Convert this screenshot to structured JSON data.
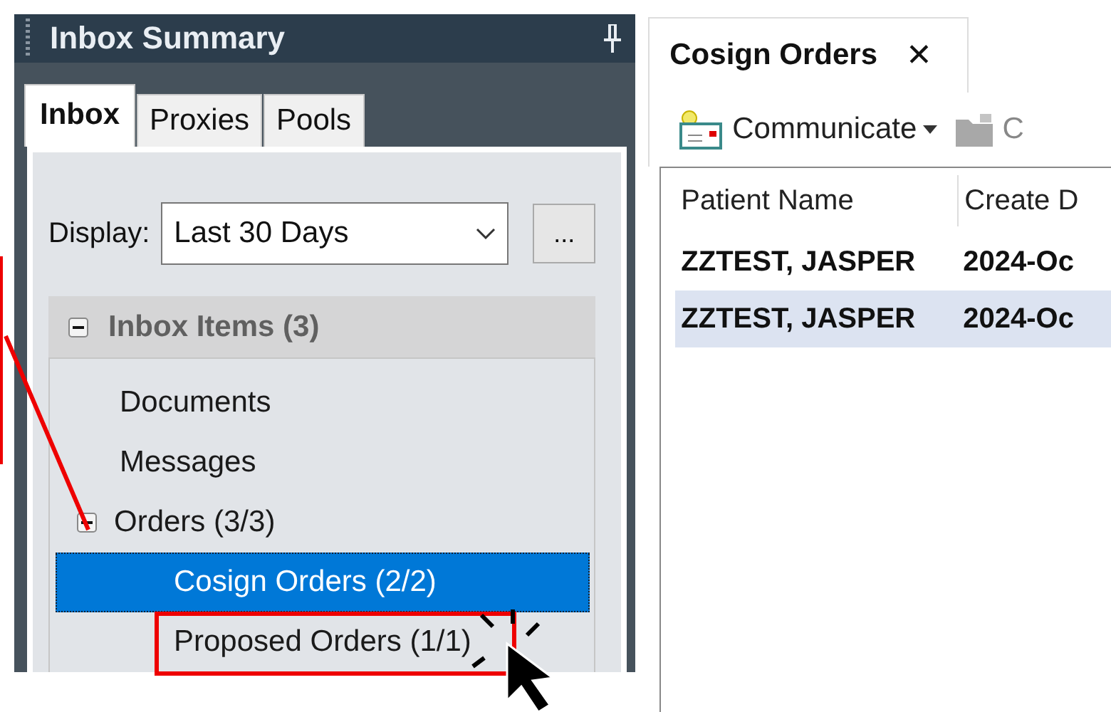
{
  "panel": {
    "title": "Inbox Summary",
    "tabs": [
      {
        "label": "Inbox",
        "selected": true
      },
      {
        "label": "Proxies",
        "selected": false
      },
      {
        "label": "Pools",
        "selected": false
      }
    ],
    "display": {
      "label": "Display:",
      "value": "Last 30 Days",
      "more_button": "..."
    },
    "tree": {
      "label": "Inbox Items (3)",
      "expanded": true,
      "children": [
        {
          "label": "Documents",
          "selected": false
        },
        {
          "label": "Messages",
          "selected": false
        },
        {
          "label": "Orders (3/3)",
          "expanded": true,
          "selected": false,
          "children": [
            {
              "label": "Cosign Orders (2/2)",
              "selected": true
            },
            {
              "label": "Proposed Orders (1/1)",
              "selected": false
            }
          ]
        }
      ]
    }
  },
  "document_tab": {
    "label": "Cosign Orders",
    "close": "✕"
  },
  "toolbar": [
    {
      "label": "Communicate",
      "kind": "dropdown"
    },
    {
      "label": "C",
      "kind": "button"
    }
  ],
  "table": {
    "columns": [
      "Patient Name",
      "Create D"
    ],
    "rows": [
      {
        "cells": [
          "ZZTEST, JASPER",
          "2024-Oc"
        ],
        "highlighted": false
      },
      {
        "cells": [
          "ZZTEST, JASPER",
          "2024-Oc"
        ],
        "highlighted": true
      }
    ]
  }
}
